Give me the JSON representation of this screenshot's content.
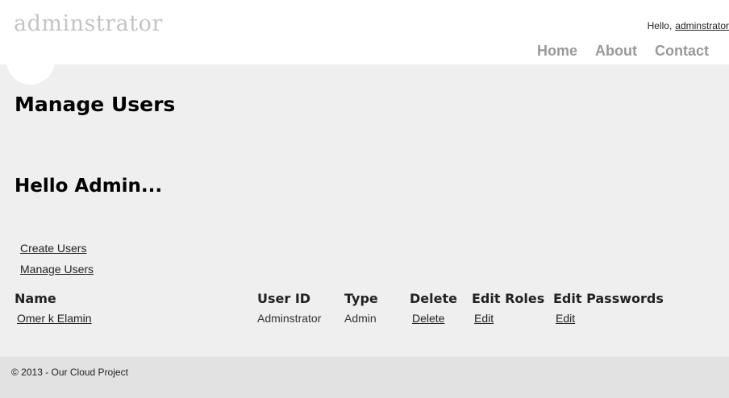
{
  "header": {
    "logo": "adminstrator",
    "greeting": "Hello,",
    "username": "adminstrator",
    "nav": [
      "Home",
      "About",
      "Contact"
    ]
  },
  "main": {
    "title": "Manage Users",
    "subtitle": "Hello Admin...",
    "links": [
      "Create Users",
      "Manage Users"
    ],
    "table": {
      "headers": [
        "Name",
        "User ID",
        "Type",
        "Delete",
        "Edit Roles",
        "Edit Passwords"
      ],
      "rows": [
        {
          "name": "Omer k Elamin",
          "user_id": "Adminstrator",
          "type": "Admin",
          "delete": "Delete",
          "edit_roles": "Edit",
          "edit_passwords": "Edit"
        }
      ]
    }
  },
  "footer": {
    "text": "© 2013 - Our Cloud Project"
  }
}
